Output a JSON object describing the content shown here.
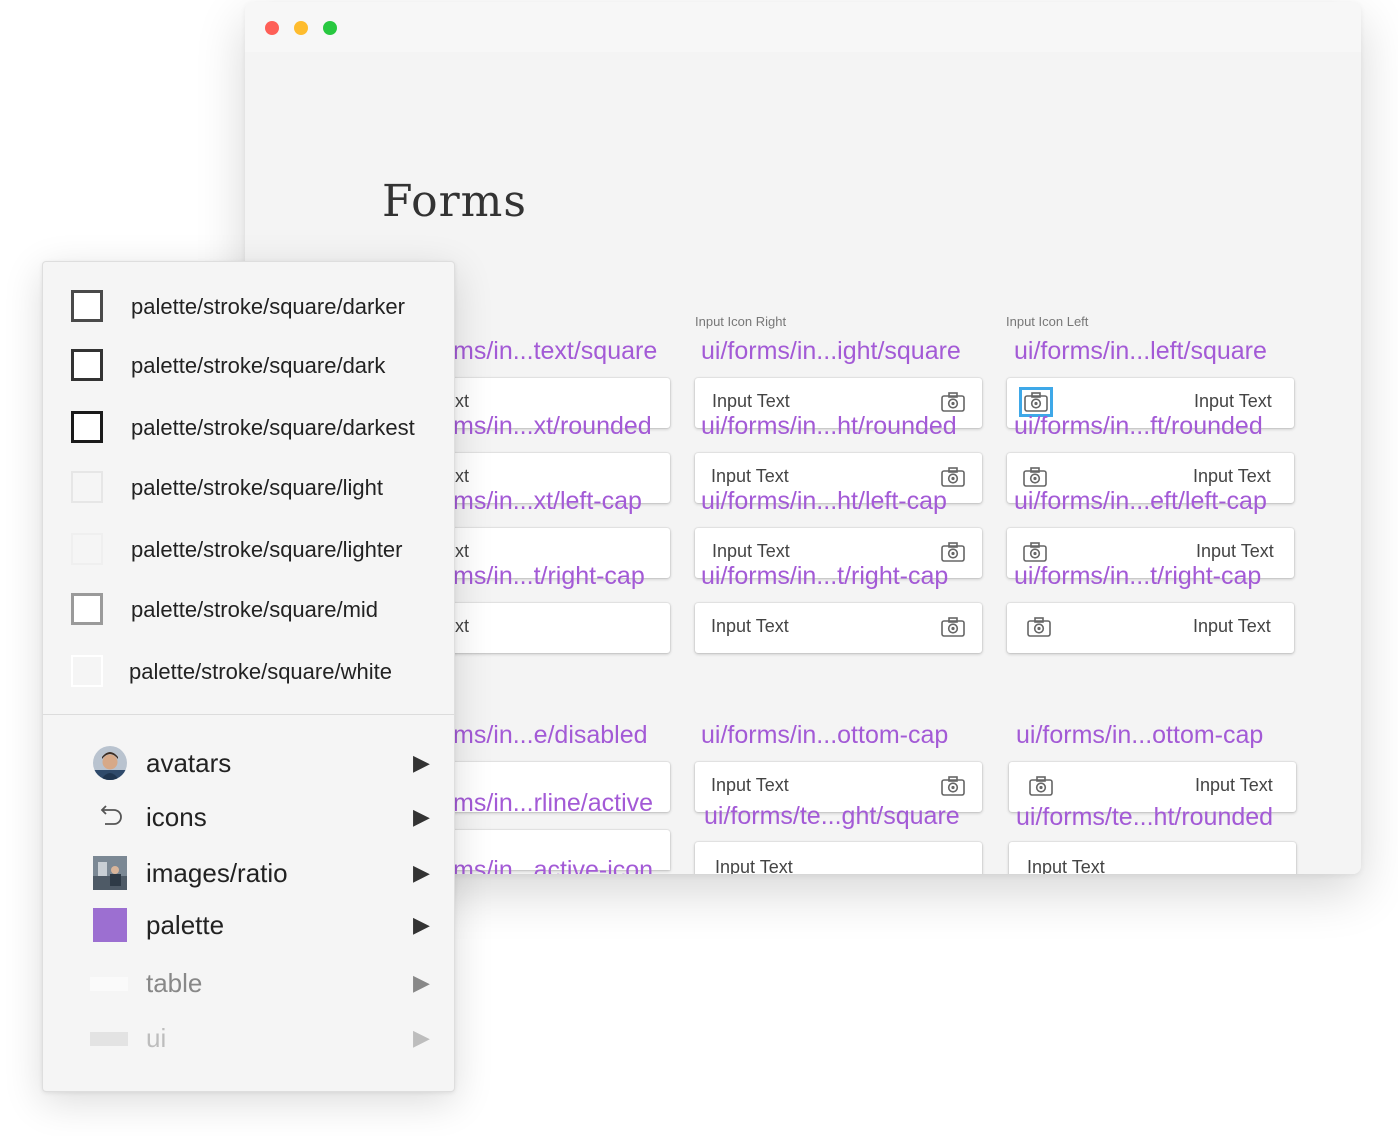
{
  "page": {
    "title": "Forms"
  },
  "columns": [
    {
      "label": "",
      "symbols": [
        "ms/in...text/square",
        "ms/in...xt/rounded",
        "ms/in...xt/left-cap",
        "ms/in...t/right-cap"
      ]
    },
    {
      "label": "Input Icon Right",
      "symbols": [
        "ui/forms/in...ight/square",
        "ui/forms/in...ht/rounded",
        "ui/forms/in...ht/left-cap",
        "ui/forms/in...t/right-cap"
      ]
    },
    {
      "label": "Input Icon Left",
      "symbols": [
        "ui/forms/in...left/square",
        "ui/forms/in...ft/rounded",
        "ui/forms/in...eft/left-cap",
        "ui/forms/in...t/right-cap"
      ]
    }
  ],
  "field_texts": {
    "input": "Input Text",
    "partial": "ext"
  },
  "lower": {
    "col1": [
      "ms/in...e/disabled",
      "ms/in...rline/active",
      "ms/in...active-icon"
    ],
    "col2": [
      "ui/forms/in...ottom-cap",
      "ui/forms/te...ght/square"
    ],
    "col3": [
      "ui/forms/in...ottom-cap",
      "ui/forms/te...ht/rounded"
    ],
    "partial_field_text_1": "t",
    "partial_field_text_2": "t"
  },
  "menu": {
    "swatches": [
      {
        "label": "palette/stroke/square/darker",
        "color": "#4a4a4a"
      },
      {
        "label": "palette/stroke/square/dark",
        "color": "#333333"
      },
      {
        "label": "palette/stroke/square/darkest",
        "color": "#1a1a1a"
      },
      {
        "label": "palette/stroke/square/light",
        "color": "#e6e6e6"
      },
      {
        "label": "palette/stroke/square/lighter",
        "color": "#f0f0f0"
      },
      {
        "label": "palette/stroke/square/mid",
        "color": "#9a9a9a"
      },
      {
        "label": "palette/stroke/square/white",
        "color": "#ffffff"
      }
    ],
    "categories": [
      {
        "label": "avatars",
        "icon": "avatar-photo-icon"
      },
      {
        "label": "icons",
        "icon": "undo-arrow-icon"
      },
      {
        "label": "images/ratio",
        "icon": "image-thumbnail-icon"
      },
      {
        "label": "palette",
        "icon": "purple-swatch-icon",
        "color": "#9c6fd1"
      },
      {
        "label": "table",
        "icon": "table-bar-icon"
      },
      {
        "label": "ui",
        "icon": "ui-bar-icon"
      }
    ],
    "arrow": "▶"
  },
  "colors": {
    "symbol_text": "#a35ad6",
    "selection": "#3ea8e8"
  }
}
